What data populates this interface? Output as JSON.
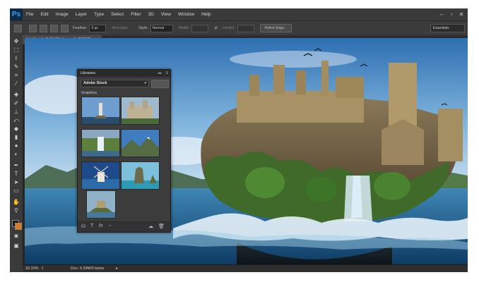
{
  "app": {
    "logo": "Ps"
  },
  "menus": [
    "File",
    "Edit",
    "Image",
    "Layer",
    "Type",
    "Select",
    "Filter",
    "3D",
    "View",
    "Window",
    "Help"
  ],
  "window_controls": [
    "–",
    "▫",
    "✕"
  ],
  "options_bar": {
    "feather_label": "Feather:",
    "feather_value": "0 px",
    "antialias_label": "Anti-alias",
    "style_label": "Style:",
    "style_value": "Normal",
    "width_label": "Width:",
    "height_label": "Height:",
    "refine_label": "Refine Edge...",
    "workspace": "Essentials"
  },
  "tools": [
    "move",
    "marquee",
    "lasso",
    "quick-select",
    "crop",
    "eyedropper",
    "healing",
    "brush",
    "clone",
    "history",
    "eraser",
    "gradient",
    "blur",
    "dodge",
    "pen",
    "type",
    "path-select",
    "shape",
    "hand",
    "zoom",
    "swap-colors",
    "mask",
    "screen-mode"
  ],
  "document_tab": "Untitled-1 @ 33.3% (Layer 1, RGB/8)",
  "status": {
    "zoom": "33.33%",
    "doc": "Doc: 6.39M/0 bytes"
  },
  "libraries": {
    "panel_title": "Libraries",
    "collapse": "▸▸",
    "library_name": "Adobe Stock",
    "section_title": "Graphics",
    "footer_icons": [
      "stamp-icon",
      "text-icon",
      "fx-icon",
      "square-icon",
      "cloud-icon",
      "trash-icon"
    ]
  },
  "colors": {
    "foreground": "#1a1a1a",
    "background": "#e07b22",
    "ps_blue": "#2fa3f0"
  }
}
